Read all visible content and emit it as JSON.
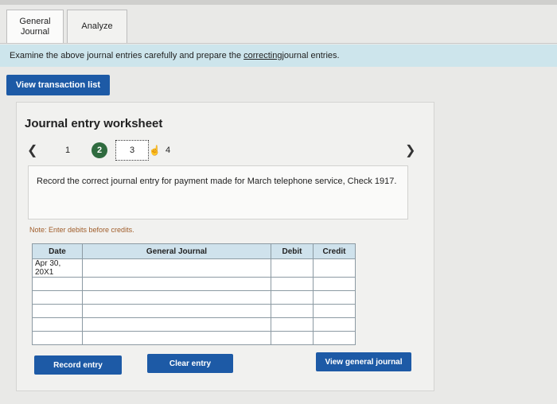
{
  "tabs": [
    {
      "label": "General\nJournal"
    },
    {
      "label": "Analyze"
    }
  ],
  "instruction": {
    "before": "Examine the above journal entries carefully and prepare the ",
    "underlined": "correcting",
    "after": " journal entries."
  },
  "view_transaction_label": "View transaction list",
  "worksheet": {
    "title": "Journal entry worksheet",
    "prev_icon": "chevron-left-icon",
    "next_icon": "chevron-right-icon",
    "steps": [
      "1",
      "2",
      "3",
      "4"
    ],
    "active_step": "2",
    "description": "Record the correct journal entry for payment made for March telephone service, Check 1917.",
    "note": "Note: Enter debits before credits."
  },
  "table": {
    "headers": {
      "date": "Date",
      "general_journal": "General Journal",
      "debit": "Debit",
      "credit": "Credit"
    },
    "first_date": "Apr 30, 20X1"
  },
  "buttons": {
    "record": "Record entry",
    "clear": "Clear entry",
    "view_general_journal": "View general journal"
  }
}
